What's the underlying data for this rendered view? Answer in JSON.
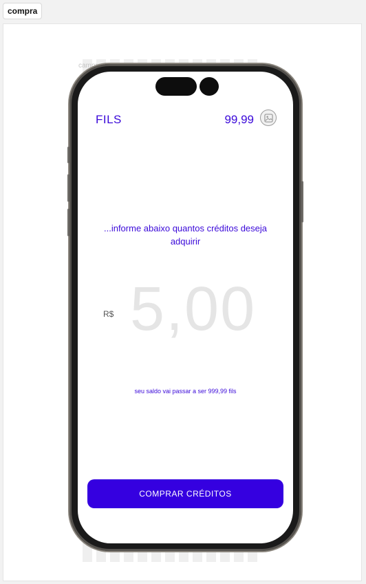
{
  "tab": {
    "label": "compra"
  },
  "frame": {
    "label": "campra"
  },
  "header": {
    "brand": "FILS",
    "balance": "99,99",
    "avatar_icon": "image-placeholder-icon"
  },
  "main": {
    "prompt": "...informe abaixo quantos créditos deseja adquirir",
    "currency": "R$",
    "amount": "5,00",
    "new_balance": "seu saldo vai passar a ser 999,99 fils"
  },
  "actions": {
    "buy_label": "COMPRAR CRÉDITOS"
  },
  "colors": {
    "accent": "#3a08d9",
    "button": "#3500e0"
  }
}
